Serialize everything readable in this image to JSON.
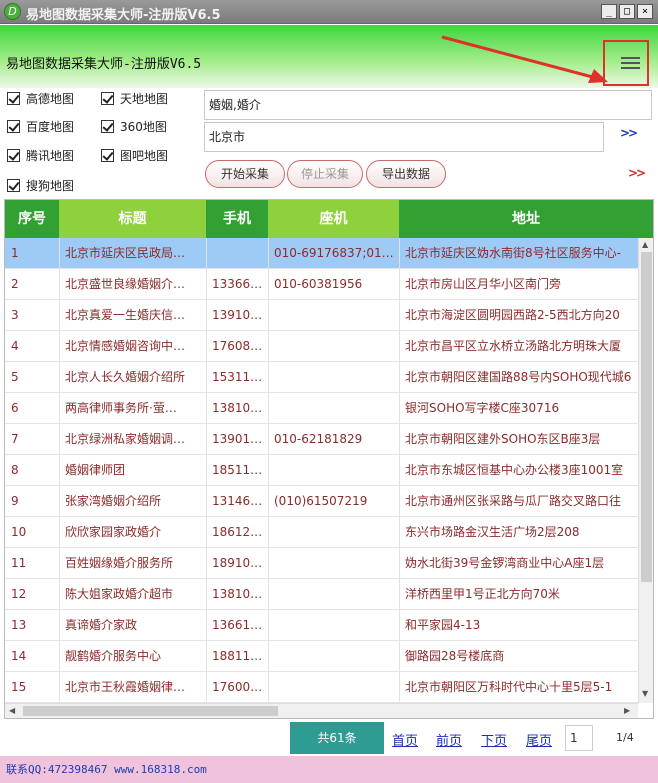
{
  "window": {
    "title": "易地图数据采集大师-注册版V6.5",
    "icon_glyph": "D",
    "buttons": [
      "_",
      "□",
      "×"
    ]
  },
  "header": {
    "app_title": "易地图数据采集大师-注册版V6.5",
    "accent_color": "#e0302a"
  },
  "sources": [
    {
      "label": "高德地图",
      "checked": true
    },
    {
      "label": "天地地图",
      "checked": true
    },
    {
      "label": "百度地图",
      "checked": true
    },
    {
      "label": "360地图",
      "checked": true
    },
    {
      "label": "腾讯地图",
      "checked": true
    },
    {
      "label": "图吧地图",
      "checked": true
    },
    {
      "label": "搜狗地图",
      "checked": true
    }
  ],
  "inputs": {
    "keywords": "婚姻,婚介",
    "city": "北京市",
    "expand_label": ">>"
  },
  "actions": {
    "start": "开始采集",
    "stop": "停止采集",
    "export": "导出数据"
  },
  "table": {
    "columns": [
      "序号",
      "标题",
      "手机",
      "座机",
      "地址"
    ],
    "header_colors": [
      "#32a032",
      "#8ed13c",
      "#32a032",
      "#8ed13c",
      "#32a032"
    ],
    "rows": [
      [
        "1",
        "北京市延庆区民政局…",
        "",
        "010-69176837;01…",
        "北京市延庆区妫水南街8号社区服务中心-"
      ],
      [
        "2",
        "北京盛世良缘婚姻介…",
        "13366…",
        "010-60381956",
        "北京市房山区月华小区南门旁"
      ],
      [
        "3",
        "北京真爱一生婚庆信…",
        "13910…",
        "",
        "北京市海淀区圆明园西路2-5西北方向20"
      ],
      [
        "4",
        "北京情感婚姻咨询中…",
        "17608…",
        "",
        "北京市昌平区立水桥立汤路北方明珠大厦"
      ],
      [
        "5",
        "北京人长久婚姻介绍所",
        "15311…",
        "",
        "北京市朝阳区建国路88号内SOHO现代城6"
      ],
      [
        "6",
        "两高律师事务所·萤…",
        "13810…",
        "",
        "银河SOHO写字楼C座30716"
      ],
      [
        "7",
        "北京绿洲私家婚姻调…",
        "13901…",
        "010-62181829",
        "北京市朝阳区建外SOHO东区B座3层"
      ],
      [
        "8",
        "婚姻律师团",
        "18511…",
        "",
        "北京市东城区恒基中心办公楼3座1001室"
      ],
      [
        "9",
        "张家湾婚姻介绍所",
        "13146…",
        "(010)61507219",
        "北京市通州区张采路与瓜厂路交叉路口往"
      ],
      [
        "10",
        "欣欣家园家政婚介",
        "18612…",
        "",
        "东兴市场路金汉生活广场2层208"
      ],
      [
        "11",
        "百姓姻缘婚介服务所",
        "18910…",
        "",
        "妫水北街39号金锣湾商业中心A座1层"
      ],
      [
        "12",
        "陈大姐家政婚介超市",
        "13810…",
        "",
        "洋桥西里甲1号正北方向70米"
      ],
      [
        "13",
        "真谛婚介家政",
        "13661…",
        "",
        "和平家园4-13"
      ],
      [
        "14",
        "靓鹤婚介服务中心",
        "18811…",
        "",
        "御路园28号楼底商"
      ],
      [
        "15",
        "北京市王秋霞婚姻律…",
        "17600…",
        "",
        "北京市朝阳区万科时代中心十里5层5-1"
      ]
    ]
  },
  "pager": {
    "total": "共61条",
    "first": "首页",
    "prev": "前页",
    "next": "下页",
    "last": "尾页",
    "page": "1",
    "count": "1/4"
  },
  "status": {
    "text": "联系QQ:472398467 www.168318.com"
  }
}
